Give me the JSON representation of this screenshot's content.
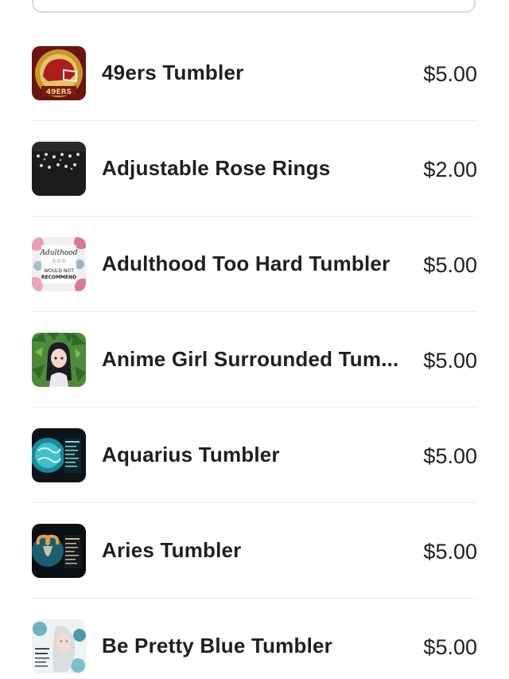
{
  "products": [
    {
      "name": "49ers Tumbler",
      "price": "$5.00",
      "thumb_icon": "49ers-helmet-image"
    },
    {
      "name": "Adjustable Rose Rings",
      "price": "$2.00",
      "thumb_icon": "rings-image"
    },
    {
      "name": "Adulthood Too Hard Tumbler",
      "price": "$5.00",
      "thumb_icon": "adulthood-floral-image",
      "thumb_text": [
        "Adulthood",
        "WOULD NOT",
        "RECOMMEND"
      ]
    },
    {
      "name": "Anime Girl Surrounded Tum...",
      "price": "$5.00",
      "thumb_icon": "anime-girl-leaves-image"
    },
    {
      "name": "Aquarius Tumbler",
      "price": "$5.00",
      "thumb_icon": "aquarius-teal-image"
    },
    {
      "name": "Aries Tumbler",
      "price": "$5.00",
      "thumb_icon": "aries-ram-image"
    },
    {
      "name": "Be Pretty Blue Tumbler",
      "price": "$5.00",
      "thumb_icon": "be-pretty-blue-image"
    }
  ],
  "colors": {
    "text": "#1f1f1f",
    "divider": "#ececec",
    "search_border": "#d9d9d9"
  }
}
